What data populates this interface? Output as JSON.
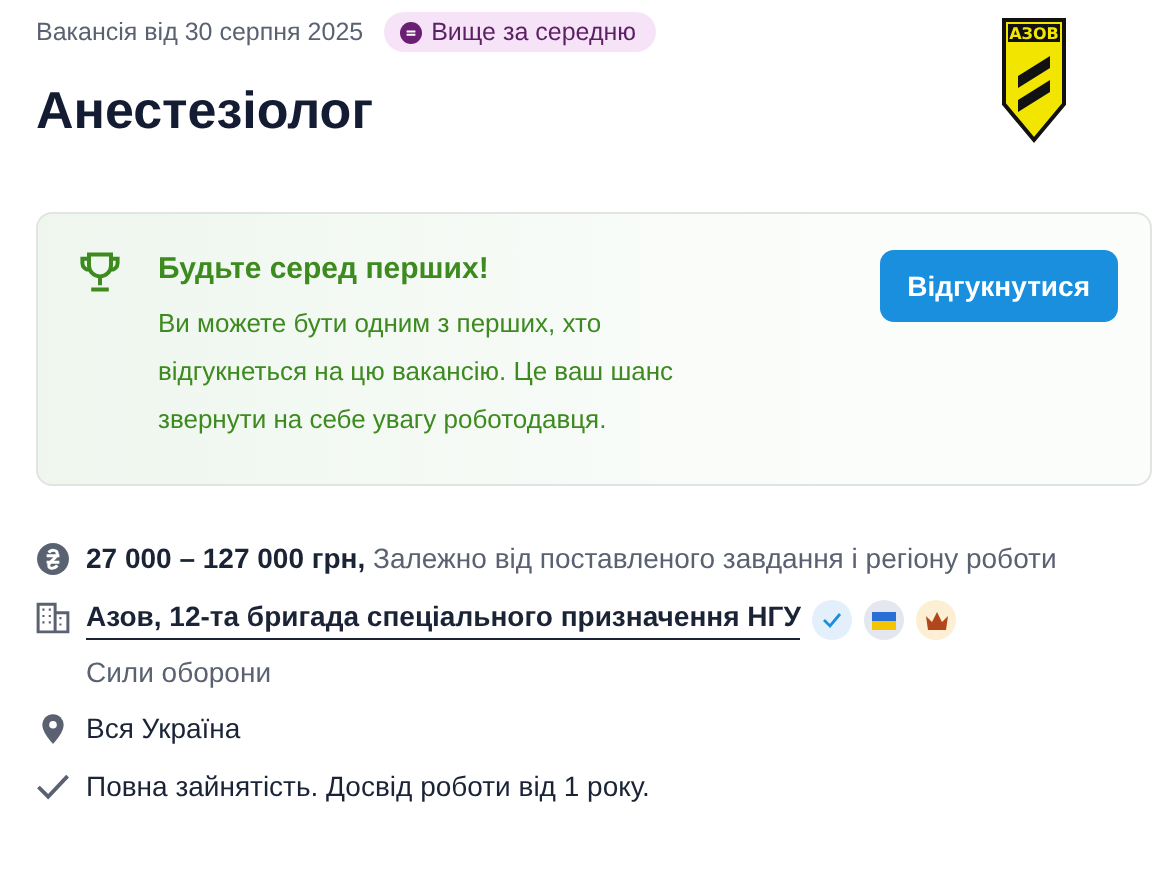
{
  "header": {
    "posted": "Вакансія від 30 серпня 2025",
    "salary_badge": "Вище за середню",
    "title": "Анестезіолог",
    "logo_text": "АЗОВ"
  },
  "callout": {
    "title": "Будьте серед перших!",
    "text": "Ви можете бути одним з перших, хто відгукнеться на цю вакансію. Це ваш шанс звернути на себе увагу роботодавця.",
    "button": "Відгукнутися"
  },
  "details": [
    {
      "kind": "salary",
      "amount": "27 000 – 127 000 грн,",
      "note": "Залежно від поставленого завдання і регіону роботи"
    },
    {
      "kind": "company",
      "name": "Азов, 12-та бригада спеціального призначення НГУ",
      "industry": "Сили оборони",
      "verified": true,
      "ukrainian": true,
      "premium": true
    },
    {
      "kind": "location",
      "text": "Вся Україна"
    },
    {
      "kind": "terms",
      "text": "Повна зайнятість. Досвід роботи від 1 року."
    }
  ]
}
